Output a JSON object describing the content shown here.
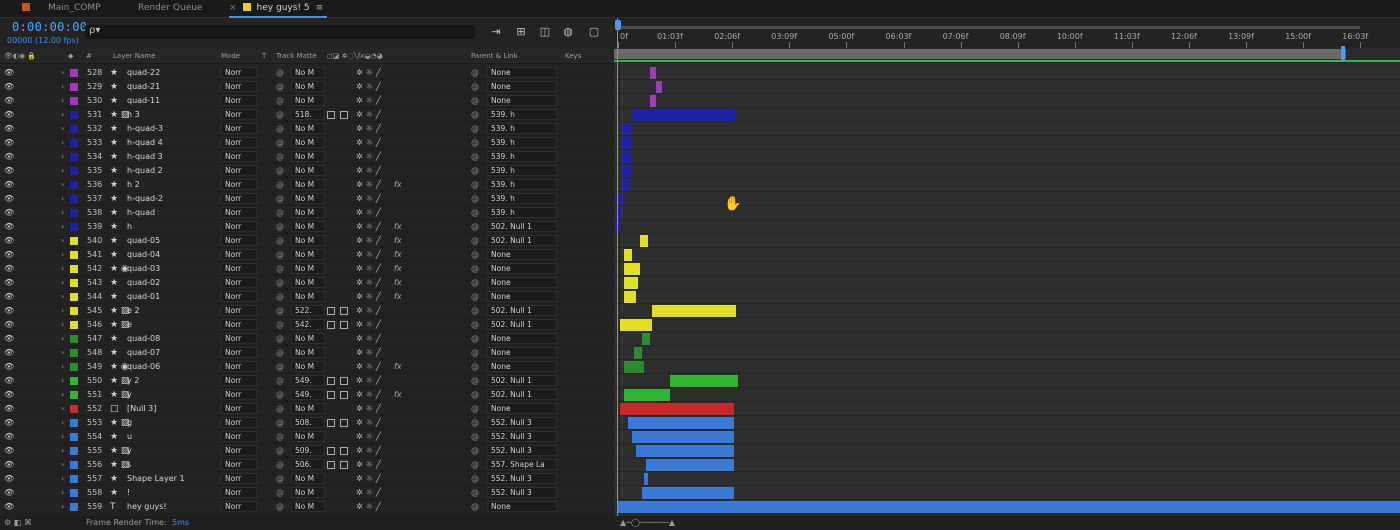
{
  "tabs": [
    {
      "label": "Main_COMP",
      "color": "#c8562c"
    },
    {
      "label": "Render Queue",
      "color": ""
    },
    {
      "label": "hey guys! 5",
      "color": "#e0d21a",
      "close": "×",
      "menu": "≡"
    }
  ],
  "header": {
    "timecode": "0:00:00:00",
    "fps": "00000 (12.00 fps)",
    "search_icon": "ρ▾"
  },
  "columns": {
    "layer_name": "Layer Name",
    "mode": "Mode",
    "t": "T",
    "track_matte": "Track Matte",
    "parent": "Parent & Link",
    "keys": "Keys",
    "hash": "#"
  },
  "layers": [
    {
      "num": "528",
      "name": "quad-22",
      "color": "#9b3bbf",
      "type": "★",
      "mode": "Norr",
      "track": "No M",
      "parent": "None",
      "fx": ""
    },
    {
      "num": "529",
      "name": "quad-21",
      "color": "#9b3bbf",
      "type": "★",
      "mode": "Norr",
      "track": "No M",
      "parent": "None",
      "fx": ""
    },
    {
      "num": "530",
      "name": "quad-11",
      "color": "#9b3bbf",
      "type": "★",
      "mode": "Norr",
      "track": "No M",
      "parent": "None",
      "fx": ""
    },
    {
      "num": "531",
      "name": "h 3",
      "color": "#2121a8",
      "type": "★ ▧",
      "mode": "Norr",
      "track": "518.",
      "parent": "539. h",
      "fx": ""
    },
    {
      "num": "532",
      "name": "h-quad-3",
      "color": "#2121a8",
      "type": "★",
      "mode": "Norr",
      "track": "No M",
      "parent": "539. h",
      "fx": ""
    },
    {
      "num": "533",
      "name": "h-quad 4",
      "color": "#2121a8",
      "type": "★",
      "mode": "Norr",
      "track": "No M",
      "parent": "539. h",
      "fx": ""
    },
    {
      "num": "534",
      "name": "h-quad 3",
      "color": "#2121a8",
      "type": "★",
      "mode": "Norr",
      "track": "No M",
      "parent": "539. h",
      "fx": ""
    },
    {
      "num": "535",
      "name": "h-quad 2",
      "color": "#2121a8",
      "type": "★",
      "mode": "Norr",
      "track": "No M",
      "parent": "539. h",
      "fx": ""
    },
    {
      "num": "536",
      "name": "h 2",
      "color": "#2121a8",
      "type": "★",
      "mode": "Norr",
      "track": "No M",
      "parent": "539. h",
      "fx": "fx"
    },
    {
      "num": "537",
      "name": "h-quad-2",
      "color": "#2121a8",
      "type": "★",
      "mode": "Norr",
      "track": "No M",
      "parent": "539. h",
      "fx": ""
    },
    {
      "num": "538",
      "name": "h-quad",
      "color": "#2121a8",
      "type": "★",
      "mode": "Norr",
      "track": "No M",
      "parent": "539. h",
      "fx": ""
    },
    {
      "num": "539",
      "name": "h",
      "color": "#2121a8",
      "type": "★",
      "mode": "Norr",
      "track": "No M",
      "parent": "502. Null 1",
      "fx": "fx"
    },
    {
      "num": "540",
      "name": "quad-05",
      "color": "#e0e020",
      "type": "★",
      "mode": "Norr",
      "track": "No M",
      "parent": "502. Null 1",
      "fx": "fx"
    },
    {
      "num": "541",
      "name": "quad-04",
      "color": "#e0e020",
      "type": "★",
      "mode": "Norr",
      "track": "No M",
      "parent": "None",
      "fx": "fx"
    },
    {
      "num": "542",
      "name": "quad-03",
      "color": "#e0e020",
      "type": "★ ◉",
      "mode": "Norr",
      "track": "No M",
      "parent": "None",
      "fx": "fx"
    },
    {
      "num": "543",
      "name": "quad-02",
      "color": "#e0e020",
      "type": "★",
      "mode": "Norr",
      "track": "No M",
      "parent": "None",
      "fx": "fx"
    },
    {
      "num": "544",
      "name": "quad-01",
      "color": "#e0e020",
      "type": "★",
      "mode": "Norr",
      "track": "No M",
      "parent": "None",
      "fx": "fx"
    },
    {
      "num": "545",
      "name": "e 2",
      "color": "#e0e020",
      "type": "★ ▧",
      "mode": "Norr",
      "track": "522.",
      "parent": "502. Null 1",
      "fx": ""
    },
    {
      "num": "546",
      "name": "e",
      "color": "#e0e020",
      "type": "★ ▧",
      "mode": "Norr",
      "track": "542.",
      "parent": "502. Null 1",
      "fx": ""
    },
    {
      "num": "547",
      "name": "quad-08",
      "color": "#2e8a2e",
      "type": "★",
      "mode": "Norr",
      "track": "No M",
      "parent": "None",
      "fx": ""
    },
    {
      "num": "548",
      "name": "quad-07",
      "color": "#2e8a2e",
      "type": "★",
      "mode": "Norr",
      "track": "No M",
      "parent": "None",
      "fx": ""
    },
    {
      "num": "549",
      "name": "quad-06",
      "color": "#2e8a2e",
      "type": "★ ◉",
      "mode": "Norr",
      "track": "No M",
      "parent": "None",
      "fx": "fx"
    },
    {
      "num": "550",
      "name": "y 2",
      "color": "#2fb52f",
      "type": "★ ▧",
      "mode": "Norr",
      "track": "549.",
      "parent": "502. Null 1",
      "fx": ""
    },
    {
      "num": "551",
      "name": "y",
      "color": "#2fb52f",
      "type": "★ ▧",
      "mode": "Norr",
      "track": "549.",
      "parent": "502. Null 1",
      "fx": "fx"
    },
    {
      "num": "552",
      "name": "[Null 3]",
      "color": "#c82828",
      "type": "□",
      "mode": "Norr",
      "track": "No M",
      "parent": "None",
      "fx": ""
    },
    {
      "num": "553",
      "name": "g",
      "color": "#3a7ad6",
      "type": "★ ▧",
      "mode": "Norr",
      "track": "508.",
      "parent": "552. Null 3",
      "fx": ""
    },
    {
      "num": "554",
      "name": "u",
      "color": "#3a7ad6",
      "type": "★",
      "mode": "Norr",
      "track": "No M",
      "parent": "552. Null 3",
      "fx": ""
    },
    {
      "num": "555",
      "name": "y",
      "color": "#3a7ad6",
      "type": "★ ▧",
      "mode": "Norr",
      "track": "509.",
      "parent": "552. Null 3",
      "fx": ""
    },
    {
      "num": "556",
      "name": "s",
      "color": "#3a7ad6",
      "type": "★ ▧",
      "mode": "Norr",
      "track": "506.",
      "parent": "557. Shape La",
      "fx": ""
    },
    {
      "num": "557",
      "name": "Shape Layer 1",
      "color": "#3a7ad6",
      "type": "★",
      "mode": "Norr",
      "track": "No M",
      "parent": "552. Null 3",
      "fx": ""
    },
    {
      "num": "558",
      "name": "!",
      "color": "#3a7ad6",
      "type": "★",
      "mode": "Norr",
      "track": "No M",
      "parent": "552. Null 3",
      "fx": ""
    },
    {
      "num": "559",
      "name": "hey guys!",
      "color": "#3a7ad6",
      "type": "T",
      "mode": "Norr",
      "track": "No M",
      "parent": "None",
      "fx": ""
    }
  ],
  "ruler_ticks": [
    "0f",
    "01:03f",
    "02:06f",
    "03:09f",
    "05:00f",
    "06:03f",
    "07:06f",
    "08:09f",
    "10:00f",
    "11:03f",
    "12:06f",
    "13:09f",
    "15:00f",
    "16:03f"
  ],
  "status": {
    "label": "Frame Render Time:",
    "value": "5ms"
  }
}
